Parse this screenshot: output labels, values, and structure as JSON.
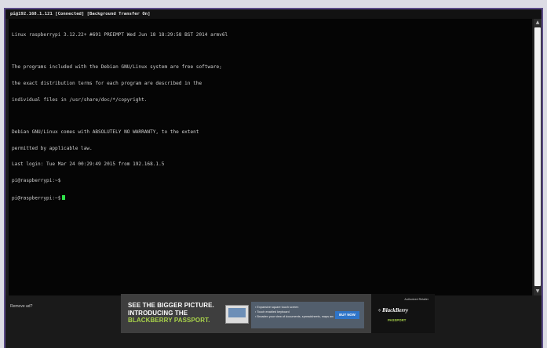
{
  "window": {
    "title": "pi@192.168.1.121 [Connected] [Background Transfer On]"
  },
  "terminal": {
    "lines": [
      "Linux raspberrypi 3.12.22+ #691 PREEMPT Wed Jun 18 18:29:58 BST 2014 armv6l",
      "",
      "The programs included with the Debian GNU/Linux system are free software;",
      "the exact distribution terms for each program are described in the",
      "individual files in /usr/share/doc/*/copyright.",
      "",
      "Debian GNU/Linux comes with ABSOLUTELY NO WARRANTY, to the extent",
      "permitted by applicable law.",
      "Last login: Tue Mar 24 00:29:49 2015 from 192.168.1.5",
      "pi@raspberrypi:~$"
    ],
    "prompt": "pi@raspberrypi:~$",
    "cursor_color": "#2fe34a"
  },
  "scrollbar": {
    "up_icon": "arrow-up-icon",
    "down_icon": "arrow-down-icon"
  },
  "status": {
    "label": "Remove ad?"
  },
  "ad": {
    "headline_1": "SEE THE BIGGER PICTURE.",
    "headline_2": "INTRODUCING THE",
    "headline_3": "BLACKBERRY PASSPORT.",
    "bullets": [
      "Expansive square touch screen",
      "Touch enabled keyboard",
      "Broaden your view of documents, spreadsheets, maps and more"
    ],
    "buy_label": "BUY NOW",
    "brand_top": "Authorized Retailer",
    "brand_name": "BlackBerry",
    "brand_sub": "PASSPORT",
    "accent_color": "#a8d24a"
  }
}
